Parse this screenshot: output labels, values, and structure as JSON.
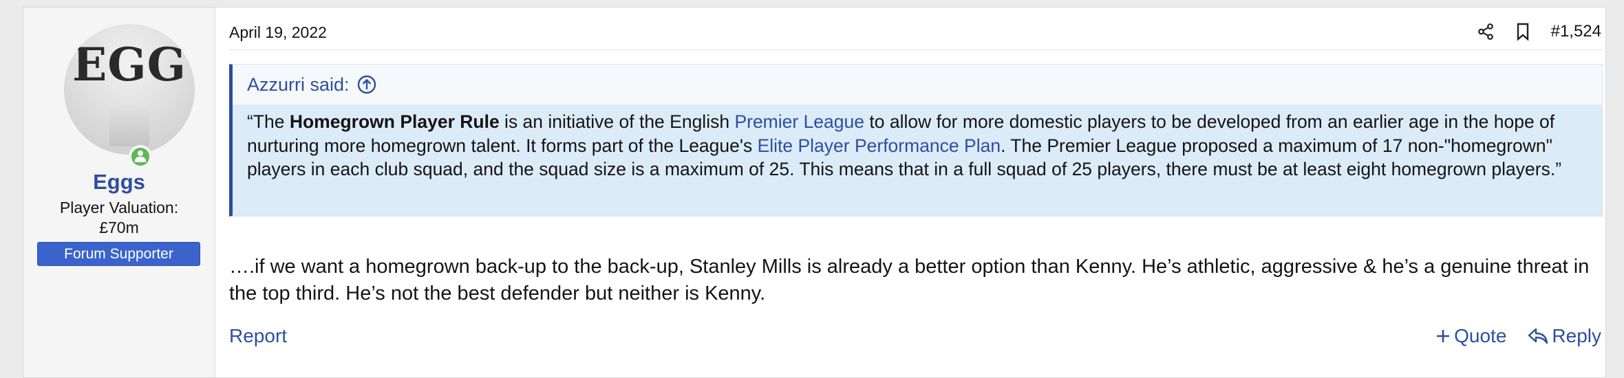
{
  "user": {
    "avatar_text": "EGG",
    "name": "Eggs",
    "title_line1": "Player Valuation:",
    "title_line2": "£70m",
    "banner": "Forum Supporter"
  },
  "post": {
    "date": "April 19, 2022",
    "number": "#1,524",
    "quote": {
      "attribution": "Azzurri said:",
      "seg1": "“The ",
      "bold": "Homegrown Player Rule",
      "seg2": " is an initiative of the English ",
      "link1": "Premier League",
      "seg3": " to allow for more domestic players to be developed from an earlier age in the hope of nurturing more homegrown talent. It forms part of the League's ",
      "link2": "Elite Player Performance Plan",
      "seg4": ". The Premier League proposed a maximum of 17 non-\"homegrown\" players in each club squad, and the squad size is a maximum of 25. This means that in a full squad of 25 players, there must be at least eight homegrown players.”"
    },
    "message": "….if we want a homegrown back-up to the back-up, Stanley Mills is already a better option than Kenny. He’s athletic, aggressive & he’s a genuine threat in the top third. He’s not the best defender but neither is Kenny."
  },
  "actions": {
    "report": "Report",
    "quote": "Quote",
    "reply": "Reply"
  },
  "colors": {
    "link": "#2d4ea0",
    "quote_bar": "#2b4c9c",
    "quote_bg": "#dcebf8",
    "banner": "#3a63cc",
    "online": "#5fb854"
  }
}
